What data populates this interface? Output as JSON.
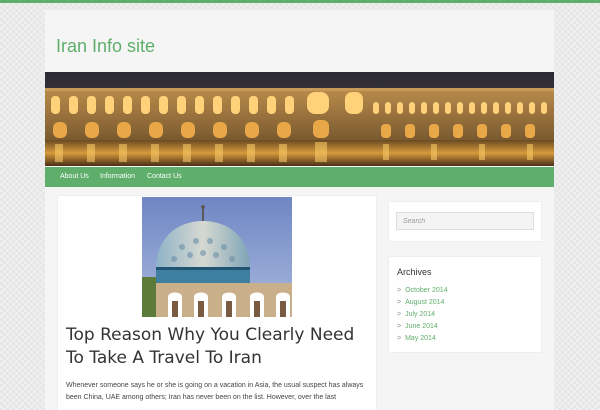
{
  "site": {
    "title": "Iran Info site",
    "accent_color": "#5fae6b"
  },
  "header": {
    "banner_icon": "bridge-at-night-image"
  },
  "nav": {
    "items": [
      {
        "label": "About Us"
      },
      {
        "label": "Information"
      },
      {
        "label": "Contact Us"
      }
    ]
  },
  "post": {
    "thumbnail_icon": "mosque-dome-image",
    "title": "Top Reason Why You Clearly Need To Take A Travel To Iran",
    "excerpt": "Whenever someone says he or she is going on a vacation in Asia, the usual suspect has always been China, UAE among others; Iran has never been on the list. However, over the last"
  },
  "sidebar": {
    "search": {
      "placeholder": "Search"
    },
    "archives": {
      "title": "Archives",
      "items": [
        {
          "label": "October 2014"
        },
        {
          "label": "August 2014"
        },
        {
          "label": "July 2014"
        },
        {
          "label": "June 2014"
        },
        {
          "label": "May 2014"
        }
      ]
    }
  }
}
